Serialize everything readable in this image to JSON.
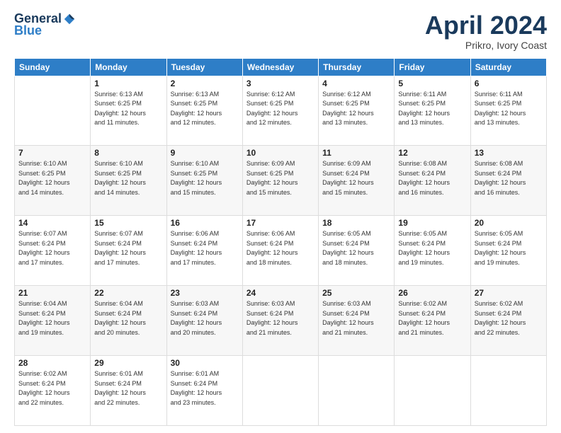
{
  "logo": {
    "general": "General",
    "blue": "Blue"
  },
  "header": {
    "title": "April 2024",
    "subtitle": "Prikro, Ivory Coast"
  },
  "days_of_week": [
    "Sunday",
    "Monday",
    "Tuesday",
    "Wednesday",
    "Thursday",
    "Friday",
    "Saturday"
  ],
  "weeks": [
    [
      {
        "day": "",
        "info": ""
      },
      {
        "day": "1",
        "info": "Sunrise: 6:13 AM\nSunset: 6:25 PM\nDaylight: 12 hours\nand 11 minutes."
      },
      {
        "day": "2",
        "info": "Sunrise: 6:13 AM\nSunset: 6:25 PM\nDaylight: 12 hours\nand 12 minutes."
      },
      {
        "day": "3",
        "info": "Sunrise: 6:12 AM\nSunset: 6:25 PM\nDaylight: 12 hours\nand 12 minutes."
      },
      {
        "day": "4",
        "info": "Sunrise: 6:12 AM\nSunset: 6:25 PM\nDaylight: 12 hours\nand 13 minutes."
      },
      {
        "day": "5",
        "info": "Sunrise: 6:11 AM\nSunset: 6:25 PM\nDaylight: 12 hours\nand 13 minutes."
      },
      {
        "day": "6",
        "info": "Sunrise: 6:11 AM\nSunset: 6:25 PM\nDaylight: 12 hours\nand 13 minutes."
      }
    ],
    [
      {
        "day": "7",
        "info": "Sunrise: 6:10 AM\nSunset: 6:25 PM\nDaylight: 12 hours\nand 14 minutes."
      },
      {
        "day": "8",
        "info": "Sunrise: 6:10 AM\nSunset: 6:25 PM\nDaylight: 12 hours\nand 14 minutes."
      },
      {
        "day": "9",
        "info": "Sunrise: 6:10 AM\nSunset: 6:25 PM\nDaylight: 12 hours\nand 15 minutes."
      },
      {
        "day": "10",
        "info": "Sunrise: 6:09 AM\nSunset: 6:25 PM\nDaylight: 12 hours\nand 15 minutes."
      },
      {
        "day": "11",
        "info": "Sunrise: 6:09 AM\nSunset: 6:24 PM\nDaylight: 12 hours\nand 15 minutes."
      },
      {
        "day": "12",
        "info": "Sunrise: 6:08 AM\nSunset: 6:24 PM\nDaylight: 12 hours\nand 16 minutes."
      },
      {
        "day": "13",
        "info": "Sunrise: 6:08 AM\nSunset: 6:24 PM\nDaylight: 12 hours\nand 16 minutes."
      }
    ],
    [
      {
        "day": "14",
        "info": "Sunrise: 6:07 AM\nSunset: 6:24 PM\nDaylight: 12 hours\nand 17 minutes."
      },
      {
        "day": "15",
        "info": "Sunrise: 6:07 AM\nSunset: 6:24 PM\nDaylight: 12 hours\nand 17 minutes."
      },
      {
        "day": "16",
        "info": "Sunrise: 6:06 AM\nSunset: 6:24 PM\nDaylight: 12 hours\nand 17 minutes."
      },
      {
        "day": "17",
        "info": "Sunrise: 6:06 AM\nSunset: 6:24 PM\nDaylight: 12 hours\nand 18 minutes."
      },
      {
        "day": "18",
        "info": "Sunrise: 6:05 AM\nSunset: 6:24 PM\nDaylight: 12 hours\nand 18 minutes."
      },
      {
        "day": "19",
        "info": "Sunrise: 6:05 AM\nSunset: 6:24 PM\nDaylight: 12 hours\nand 19 minutes."
      },
      {
        "day": "20",
        "info": "Sunrise: 6:05 AM\nSunset: 6:24 PM\nDaylight: 12 hours\nand 19 minutes."
      }
    ],
    [
      {
        "day": "21",
        "info": "Sunrise: 6:04 AM\nSunset: 6:24 PM\nDaylight: 12 hours\nand 19 minutes."
      },
      {
        "day": "22",
        "info": "Sunrise: 6:04 AM\nSunset: 6:24 PM\nDaylight: 12 hours\nand 20 minutes."
      },
      {
        "day": "23",
        "info": "Sunrise: 6:03 AM\nSunset: 6:24 PM\nDaylight: 12 hours\nand 20 minutes."
      },
      {
        "day": "24",
        "info": "Sunrise: 6:03 AM\nSunset: 6:24 PM\nDaylight: 12 hours\nand 21 minutes."
      },
      {
        "day": "25",
        "info": "Sunrise: 6:03 AM\nSunset: 6:24 PM\nDaylight: 12 hours\nand 21 minutes."
      },
      {
        "day": "26",
        "info": "Sunrise: 6:02 AM\nSunset: 6:24 PM\nDaylight: 12 hours\nand 21 minutes."
      },
      {
        "day": "27",
        "info": "Sunrise: 6:02 AM\nSunset: 6:24 PM\nDaylight: 12 hours\nand 22 minutes."
      }
    ],
    [
      {
        "day": "28",
        "info": "Sunrise: 6:02 AM\nSunset: 6:24 PM\nDaylight: 12 hours\nand 22 minutes."
      },
      {
        "day": "29",
        "info": "Sunrise: 6:01 AM\nSunset: 6:24 PM\nDaylight: 12 hours\nand 22 minutes."
      },
      {
        "day": "30",
        "info": "Sunrise: 6:01 AM\nSunset: 6:24 PM\nDaylight: 12 hours\nand 23 minutes."
      },
      {
        "day": "",
        "info": ""
      },
      {
        "day": "",
        "info": ""
      },
      {
        "day": "",
        "info": ""
      },
      {
        "day": "",
        "info": ""
      }
    ]
  ]
}
